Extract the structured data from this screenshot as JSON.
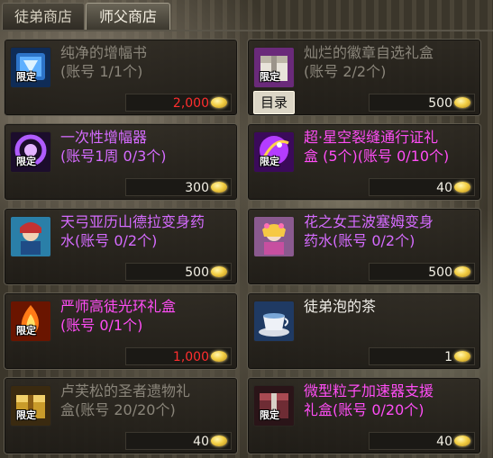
{
  "tabs": [
    {
      "label": "徒弟商店",
      "active": false
    },
    {
      "label": "师父商店",
      "active": true
    }
  ],
  "badge_label": "限定",
  "tooltip_label": "目录",
  "colors": {
    "gray_text": "#8a857a",
    "purple_text": "#d56bff",
    "magenta_text": "#ff4df6",
    "white_text": "#f0eee8",
    "price_red": "#ff2e2e",
    "price_white": "#f4f1e6"
  },
  "items": [
    {
      "name": "纯净的增幅书\n(账号 1/1个)",
      "price": "2,000",
      "name_color": "#8a857a",
      "price_color": "#ff2e2e",
      "icon": "blue-tome-icon",
      "limited": true
    },
    {
      "name": "灿烂的徽章自选礼盒\n(账号 2/2个)",
      "price": "500",
      "name_color": "#8a857a",
      "price_color": "#f4f1e6",
      "icon": "gift-box-icon",
      "limited": true
    },
    {
      "name": "一次性增幅器\n(账号1周 0/3个)",
      "price": "300",
      "name_color": "#d56bff",
      "price_color": "#f4f1e6",
      "icon": "purple-amplifier-icon",
      "limited": true
    },
    {
      "name": "超·星空裂缝通行证礼\n盒 (5个)(账号 0/10个)",
      "price": "40",
      "name_color": "#ff4df6",
      "price_color": "#f4f1e6",
      "icon": "starry-rift-pass-icon",
      "limited": true
    },
    {
      "name": "天弓亚历山德拉变身药\n水(账号 0/2个)",
      "price": "500",
      "name_color": "#d56bff",
      "price_color": "#f4f1e6",
      "icon": "blue-potion-character-icon",
      "limited": false
    },
    {
      "name": "花之女王波塞姆变身\n药水(账号 0/2个)",
      "price": "500",
      "name_color": "#d56bff",
      "price_color": "#f4f1e6",
      "icon": "flower-queen-potion-icon",
      "limited": false
    },
    {
      "name": "严师高徒光环礼盒\n(账号 0/1个)",
      "price": "1,000",
      "name_color": "#ff4df6",
      "price_color": "#ff2e2e",
      "icon": "fire-aura-box-icon",
      "limited": true
    },
    {
      "name": "徒弟泡的茶",
      "price": "1",
      "name_color": "#f0eee8",
      "price_color": "#f4f1e6",
      "icon": "tea-cup-icon",
      "limited": false
    },
    {
      "name": "卢芙松的圣者遗物礼\n盒(账号 20/20个)",
      "price": "40",
      "name_color": "#8a857a",
      "price_color": "#f4f1e6",
      "icon": "golden-relic-chest-icon",
      "limited": true
    },
    {
      "name": "微型粒子加速器支援\n礼盒(账号 0/20个)",
      "price": "40",
      "name_color": "#ff4df6",
      "price_color": "#f4f1e6",
      "icon": "particle-accelerator-box-icon",
      "limited": true
    }
  ]
}
